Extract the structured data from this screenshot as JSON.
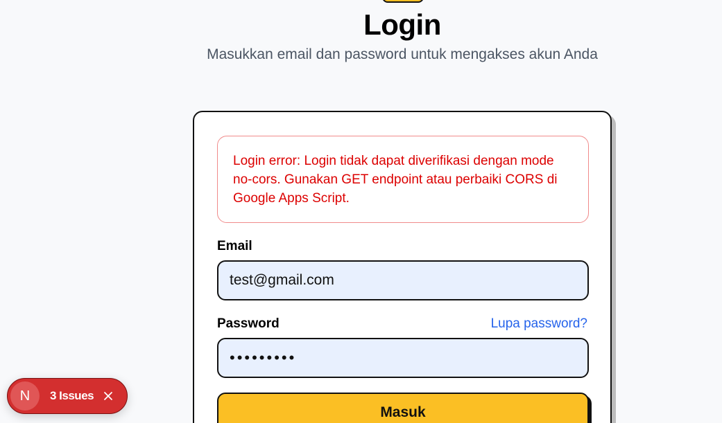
{
  "header": {
    "title": "Login",
    "subtitle": "Masukkan email dan password untuk mengakses akun Anda"
  },
  "alert": {
    "message": "Login error: Login tidak dapat diverifikasi dengan mode no-cors. Gunakan GET endpoint atau perbaiki CORS di Google Apps Script."
  },
  "form": {
    "email_label": "Email",
    "email_value": "test@gmail.com",
    "password_label": "Password",
    "password_value": "•••••••••",
    "forgot_link": "Lupa password?",
    "submit_label": "Masuk"
  },
  "issues_badge": {
    "avatar_letter": "N",
    "label": "3 Issues",
    "close_icon": "close-icon"
  },
  "colors": {
    "accent": "#fbbf24",
    "error": "#dc0000",
    "link": "#2563eb",
    "issues_bg": "#d32f2f"
  }
}
